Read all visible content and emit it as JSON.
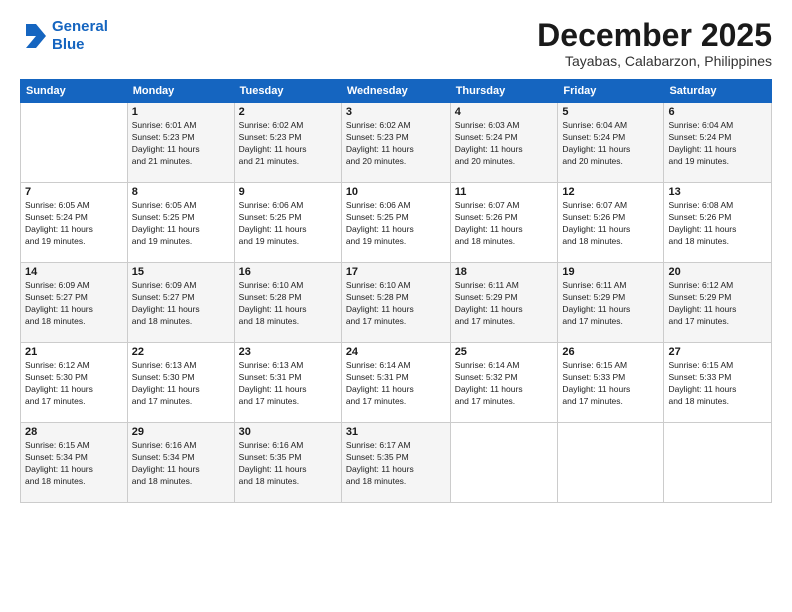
{
  "logo": {
    "line1": "General",
    "line2": "Blue"
  },
  "title": "December 2025",
  "location": "Tayabas, Calabarzon, Philippines",
  "days_header": [
    "Sunday",
    "Monday",
    "Tuesday",
    "Wednesday",
    "Thursday",
    "Friday",
    "Saturday"
  ],
  "weeks": [
    [
      {
        "num": "",
        "info": ""
      },
      {
        "num": "1",
        "info": "Sunrise: 6:01 AM\nSunset: 5:23 PM\nDaylight: 11 hours\nand 21 minutes."
      },
      {
        "num": "2",
        "info": "Sunrise: 6:02 AM\nSunset: 5:23 PM\nDaylight: 11 hours\nand 21 minutes."
      },
      {
        "num": "3",
        "info": "Sunrise: 6:02 AM\nSunset: 5:23 PM\nDaylight: 11 hours\nand 20 minutes."
      },
      {
        "num": "4",
        "info": "Sunrise: 6:03 AM\nSunset: 5:24 PM\nDaylight: 11 hours\nand 20 minutes."
      },
      {
        "num": "5",
        "info": "Sunrise: 6:04 AM\nSunset: 5:24 PM\nDaylight: 11 hours\nand 20 minutes."
      },
      {
        "num": "6",
        "info": "Sunrise: 6:04 AM\nSunset: 5:24 PM\nDaylight: 11 hours\nand 19 minutes."
      }
    ],
    [
      {
        "num": "7",
        "info": "Sunrise: 6:05 AM\nSunset: 5:24 PM\nDaylight: 11 hours\nand 19 minutes."
      },
      {
        "num": "8",
        "info": "Sunrise: 6:05 AM\nSunset: 5:25 PM\nDaylight: 11 hours\nand 19 minutes."
      },
      {
        "num": "9",
        "info": "Sunrise: 6:06 AM\nSunset: 5:25 PM\nDaylight: 11 hours\nand 19 minutes."
      },
      {
        "num": "10",
        "info": "Sunrise: 6:06 AM\nSunset: 5:25 PM\nDaylight: 11 hours\nand 19 minutes."
      },
      {
        "num": "11",
        "info": "Sunrise: 6:07 AM\nSunset: 5:26 PM\nDaylight: 11 hours\nand 18 minutes."
      },
      {
        "num": "12",
        "info": "Sunrise: 6:07 AM\nSunset: 5:26 PM\nDaylight: 11 hours\nand 18 minutes."
      },
      {
        "num": "13",
        "info": "Sunrise: 6:08 AM\nSunset: 5:26 PM\nDaylight: 11 hours\nand 18 minutes."
      }
    ],
    [
      {
        "num": "14",
        "info": "Sunrise: 6:09 AM\nSunset: 5:27 PM\nDaylight: 11 hours\nand 18 minutes."
      },
      {
        "num": "15",
        "info": "Sunrise: 6:09 AM\nSunset: 5:27 PM\nDaylight: 11 hours\nand 18 minutes."
      },
      {
        "num": "16",
        "info": "Sunrise: 6:10 AM\nSunset: 5:28 PM\nDaylight: 11 hours\nand 18 minutes."
      },
      {
        "num": "17",
        "info": "Sunrise: 6:10 AM\nSunset: 5:28 PM\nDaylight: 11 hours\nand 17 minutes."
      },
      {
        "num": "18",
        "info": "Sunrise: 6:11 AM\nSunset: 5:29 PM\nDaylight: 11 hours\nand 17 minutes."
      },
      {
        "num": "19",
        "info": "Sunrise: 6:11 AM\nSunset: 5:29 PM\nDaylight: 11 hours\nand 17 minutes."
      },
      {
        "num": "20",
        "info": "Sunrise: 6:12 AM\nSunset: 5:29 PM\nDaylight: 11 hours\nand 17 minutes."
      }
    ],
    [
      {
        "num": "21",
        "info": "Sunrise: 6:12 AM\nSunset: 5:30 PM\nDaylight: 11 hours\nand 17 minutes."
      },
      {
        "num": "22",
        "info": "Sunrise: 6:13 AM\nSunset: 5:30 PM\nDaylight: 11 hours\nand 17 minutes."
      },
      {
        "num": "23",
        "info": "Sunrise: 6:13 AM\nSunset: 5:31 PM\nDaylight: 11 hours\nand 17 minutes."
      },
      {
        "num": "24",
        "info": "Sunrise: 6:14 AM\nSunset: 5:31 PM\nDaylight: 11 hours\nand 17 minutes."
      },
      {
        "num": "25",
        "info": "Sunrise: 6:14 AM\nSunset: 5:32 PM\nDaylight: 11 hours\nand 17 minutes."
      },
      {
        "num": "26",
        "info": "Sunrise: 6:15 AM\nSunset: 5:33 PM\nDaylight: 11 hours\nand 17 minutes."
      },
      {
        "num": "27",
        "info": "Sunrise: 6:15 AM\nSunset: 5:33 PM\nDaylight: 11 hours\nand 18 minutes."
      }
    ],
    [
      {
        "num": "28",
        "info": "Sunrise: 6:15 AM\nSunset: 5:34 PM\nDaylight: 11 hours\nand 18 minutes."
      },
      {
        "num": "29",
        "info": "Sunrise: 6:16 AM\nSunset: 5:34 PM\nDaylight: 11 hours\nand 18 minutes."
      },
      {
        "num": "30",
        "info": "Sunrise: 6:16 AM\nSunset: 5:35 PM\nDaylight: 11 hours\nand 18 minutes."
      },
      {
        "num": "31",
        "info": "Sunrise: 6:17 AM\nSunset: 5:35 PM\nDaylight: 11 hours\nand 18 minutes."
      },
      {
        "num": "",
        "info": ""
      },
      {
        "num": "",
        "info": ""
      },
      {
        "num": "",
        "info": ""
      }
    ]
  ]
}
